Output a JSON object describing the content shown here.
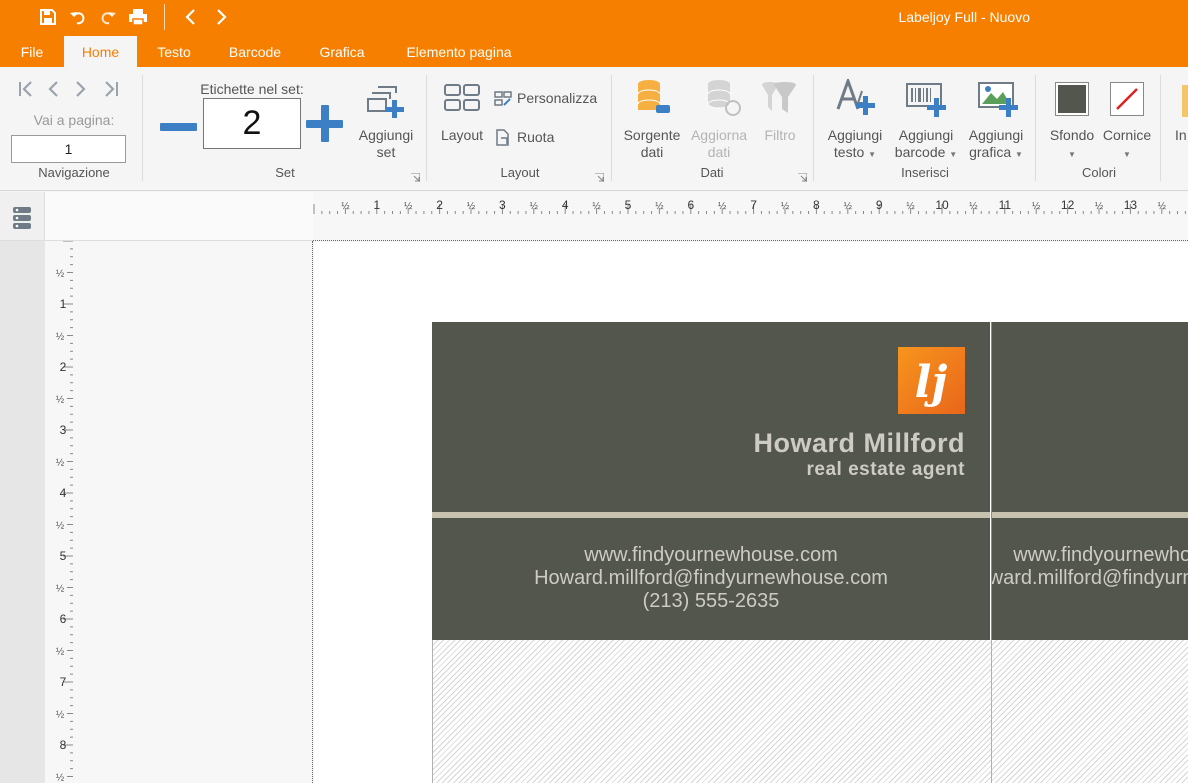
{
  "window": {
    "title": "Labeljoy Full - Nuovo"
  },
  "quick_access": {
    "icons": [
      "save-icon",
      "undo-icon",
      "redo-icon",
      "print-icon",
      "back-icon",
      "forward-icon"
    ]
  },
  "menu": {
    "tabs": [
      {
        "label": "File"
      },
      {
        "label": "Home",
        "active": true
      },
      {
        "label": "Testo"
      },
      {
        "label": "Barcode"
      },
      {
        "label": "Grafica"
      },
      {
        "label": "Elemento pagina"
      }
    ]
  },
  "ribbon": {
    "navigation": {
      "goto_label": "Vai a pagina:",
      "page_value": "1",
      "group_label": "Navigazione"
    },
    "set": {
      "labels_caption": "Etichette nel set:",
      "labels_value": "2",
      "add_set_line1": "Aggiungi",
      "add_set_line2": "set",
      "group_label": "Set"
    },
    "layout": {
      "layout_label": "Layout",
      "customize_label": "Personalizza",
      "rotate_label": "Ruota",
      "group_label": "Layout"
    },
    "data": {
      "source_line1": "Sorgente",
      "source_line2": "dati",
      "update_line1": "Aggiorna",
      "update_line2": "dati",
      "filter_label": "Filtro",
      "group_label": "Dati"
    },
    "insert": {
      "text_line1": "Aggiungi",
      "text_line2": "testo",
      "barcode_line1": "Aggiungi",
      "barcode_line2": "barcode",
      "graphic_line1": "Aggiungi",
      "graphic_line2": "grafica",
      "group_label": "Inserisci"
    },
    "colors": {
      "background_label": "Sfondo",
      "frame_label": "Cornice",
      "background_color": "#52564d",
      "frame_color": "#e02020",
      "group_label": "Colori"
    },
    "overflow": {
      "label": "In"
    }
  },
  "ruler": {
    "half_mark": "½",
    "h_numbers": [
      "1",
      "2",
      "3",
      "4",
      "5",
      "6",
      "7",
      "8",
      "9",
      "10",
      "11",
      "12",
      "13"
    ],
    "v_numbers": [
      "1",
      "2",
      "3",
      "4",
      "5",
      "6",
      "7",
      "8"
    ]
  },
  "card": {
    "name": "Howard Millford",
    "role": "real estate agent",
    "website": "www.findyournewhouse.com",
    "email": "Howard.millford@findyurnewhouse.com",
    "phone": "(213) 555-2635",
    "logo_text": "lj",
    "colors": {
      "background": "#52564d",
      "stripe": "#c6c2ad",
      "text": "#cdcbc4",
      "logo": "#f7951d"
    }
  }
}
